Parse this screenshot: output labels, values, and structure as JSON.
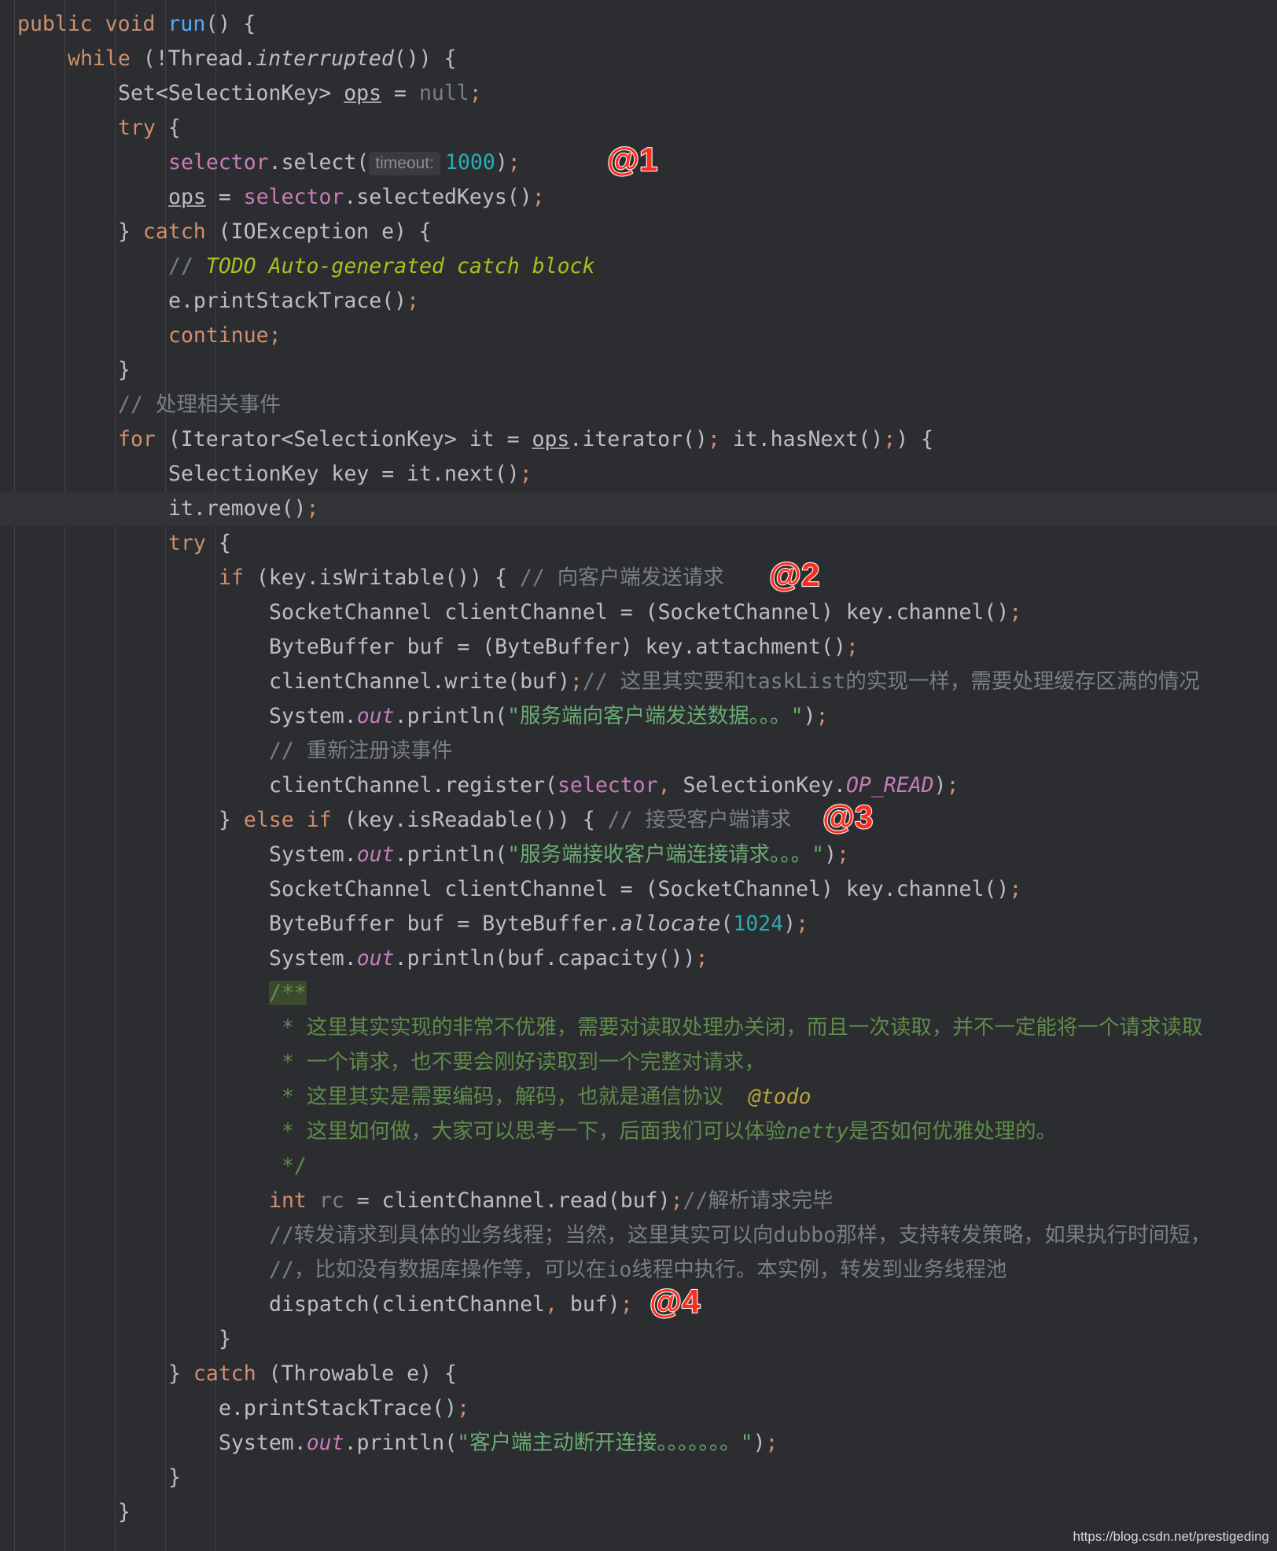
{
  "editor": {
    "lines": [
      {
        "indent": 0,
        "tokens": [
          [
            "kw",
            "public void "
          ],
          [
            "fn",
            "run"
          ],
          [
            "",
            "() {"
          ]
        ]
      },
      {
        "indent": 1,
        "tokens": [
          [
            "kw",
            "while "
          ],
          [
            "",
            "(!Thread."
          ],
          [
            "ital",
            "interrupted"
          ],
          [
            "",
            "()) {"
          ]
        ]
      },
      {
        "indent": 2,
        "tokens": [
          [
            "",
            "Set<SelectionKey> "
          ],
          [
            "und",
            "ops"
          ],
          [
            "",
            " = "
          ],
          [
            "dim",
            "null"
          ],
          [
            "kw",
            ";"
          ]
        ]
      },
      {
        "indent": 2,
        "tokens": [
          [
            "kw",
            "try "
          ],
          [
            "",
            "{"
          ]
        ]
      },
      {
        "indent": 3,
        "tokens": [
          [
            "fld",
            "selector"
          ],
          [
            "",
            ".select("
          ],
          [
            "hint",
            "timeout:"
          ],
          [
            "num",
            "1000"
          ],
          [
            "",
            ")"
          ],
          [
            "kw",
            ";"
          ]
        ]
      },
      {
        "indent": 3,
        "tokens": [
          [
            "und",
            "ops"
          ],
          [
            "",
            " = "
          ],
          [
            "fld",
            "selector"
          ],
          [
            "",
            ".selectedKeys()"
          ],
          [
            "kw",
            ";"
          ]
        ]
      },
      {
        "indent": 2,
        "tokens": [
          [
            "",
            "} "
          ],
          [
            "kw",
            "catch "
          ],
          [
            "",
            "(IOException e) {"
          ]
        ]
      },
      {
        "indent": 3,
        "tokens": [
          [
            "cmt",
            "// "
          ],
          [
            "todo",
            "TODO Auto-generated catch block"
          ]
        ]
      },
      {
        "indent": 3,
        "tokens": [
          [
            "",
            "e.printStackTrace()"
          ],
          [
            "kw",
            ";"
          ]
        ]
      },
      {
        "indent": 3,
        "tokens": [
          [
            "kw",
            "continue;"
          ]
        ]
      },
      {
        "indent": 2,
        "tokens": [
          [
            "",
            "}"
          ]
        ]
      },
      {
        "indent": 2,
        "tokens": [
          [
            "cmt",
            "// 处理相关事件"
          ]
        ]
      },
      {
        "indent": 2,
        "tokens": [
          [
            "kw",
            "for "
          ],
          [
            "",
            "(Iterator<SelectionKey> it = "
          ],
          [
            "und",
            "ops"
          ],
          [
            "",
            ".iterator()"
          ],
          [
            "kw",
            "; "
          ],
          [
            "",
            "it.hasNext()"
          ],
          [
            "kw",
            ";"
          ],
          [
            "",
            ") {"
          ]
        ]
      },
      {
        "indent": 3,
        "tokens": [
          [
            "",
            "SelectionKey key = it.next()"
          ],
          [
            "kw",
            ";"
          ]
        ]
      },
      {
        "indent": 3,
        "current": true,
        "tokens": [
          [
            "",
            "it.remove()"
          ],
          [
            "kw",
            ";"
          ]
        ]
      },
      {
        "indent": 3,
        "tokens": [
          [
            "kw",
            "try "
          ],
          [
            "",
            "{"
          ]
        ]
      },
      {
        "indent": 4,
        "tokens": [
          [
            "kw",
            "if "
          ],
          [
            "",
            "(key.isWritable()) { "
          ],
          [
            "cmt",
            "// 向客户端发送请求"
          ]
        ]
      },
      {
        "indent": 5,
        "tokens": [
          [
            "",
            "SocketChannel clientChannel = (SocketChannel) key.channel()"
          ],
          [
            "kw",
            ";"
          ]
        ]
      },
      {
        "indent": 5,
        "tokens": [
          [
            "",
            "ByteBuffer buf = (ByteBuffer) key.attachment()"
          ],
          [
            "kw",
            ";"
          ]
        ]
      },
      {
        "indent": 5,
        "tokens": [
          [
            "",
            "clientChannel.write(buf)"
          ],
          [
            "kw",
            ";"
          ],
          [
            "cmt",
            "// 这里其实要和taskList的实现一样，需要处理缓存区满的情况"
          ]
        ]
      },
      {
        "indent": 5,
        "tokens": [
          [
            "",
            "System."
          ],
          [
            "fld ital",
            "out"
          ],
          [
            "",
            ".println("
          ],
          [
            "str",
            "\"服务端向客户端发送数据。。。\""
          ],
          [
            "",
            ")"
          ],
          [
            "kw",
            ";"
          ]
        ]
      },
      {
        "indent": 5,
        "tokens": [
          [
            "cmt",
            "// 重新注册读事件"
          ]
        ]
      },
      {
        "indent": 5,
        "tokens": [
          [
            "",
            "clientChannel.register("
          ],
          [
            "fld",
            "selector"
          ],
          [
            "kw",
            ", "
          ],
          [
            "",
            "SelectionKey."
          ],
          [
            "fld ital",
            "OP_READ"
          ],
          [
            "",
            ")"
          ],
          [
            "kw",
            ";"
          ]
        ]
      },
      {
        "indent": 4,
        "tokens": [
          [
            "",
            "} "
          ],
          [
            "kw",
            "else if "
          ],
          [
            "",
            "(key.isReadable()) { "
          ],
          [
            "cmt",
            "// 接受客户端请求"
          ]
        ]
      },
      {
        "indent": 5,
        "tokens": [
          [
            "",
            "System."
          ],
          [
            "fld ital",
            "out"
          ],
          [
            "",
            ".println("
          ],
          [
            "str",
            "\"服务端接收客户端连接请求。。。\""
          ],
          [
            "",
            ")"
          ],
          [
            "kw",
            ";"
          ]
        ]
      },
      {
        "indent": 5,
        "tokens": [
          [
            "",
            "SocketChannel clientChannel = (SocketChannel) key.channel()"
          ],
          [
            "kw",
            ";"
          ]
        ]
      },
      {
        "indent": 5,
        "tokens": [
          [
            "",
            "ByteBuffer buf = ByteBuffer."
          ],
          [
            "ital",
            "allocate"
          ],
          [
            "",
            "("
          ],
          [
            "num",
            "1024"
          ],
          [
            "",
            ")"
          ],
          [
            "kw",
            ";"
          ]
        ]
      },
      {
        "indent": 5,
        "tokens": [
          [
            "",
            "System."
          ],
          [
            "fld ital",
            "out"
          ],
          [
            "",
            ".println(buf.capacity())"
          ],
          [
            "kw",
            ";"
          ]
        ]
      },
      {
        "indent": 5,
        "tokens": [
          [
            "docstart",
            "/**"
          ]
        ]
      },
      {
        "indent": 5,
        "tokens": [
          [
            "doc",
            " * 这里其实实现的非常不优雅，需要对读取处理办关闭，而且一次读取，并不一定能将一个请求读取"
          ]
        ]
      },
      {
        "indent": 5,
        "tokens": [
          [
            "doc",
            " * 一个请求，也不要会刚好读取到一个完整对请求，"
          ]
        ]
      },
      {
        "indent": 5,
        "tokens": [
          [
            "doc",
            " * 这里其实是需要编码，解码，也就是通信协议  "
          ],
          [
            "tag",
            "@todo"
          ]
        ]
      },
      {
        "indent": 5,
        "tokens": [
          [
            "doc",
            " * 这里如何做，大家可以思考一下，后面我们可以体验"
          ],
          [
            "doc ital",
            "netty"
          ],
          [
            "doc",
            "是否如何优雅处理的。"
          ]
        ]
      },
      {
        "indent": 5,
        "tokens": [
          [
            "doc",
            " */"
          ]
        ]
      },
      {
        "indent": 5,
        "tokens": [
          [
            "kw",
            "int "
          ],
          [
            "dim",
            "rc"
          ],
          [
            "",
            " = clientChannel.read(buf)"
          ],
          [
            "kw",
            ";"
          ],
          [
            "cmt",
            "//解析请求完毕"
          ]
        ]
      },
      {
        "indent": 5,
        "tokens": [
          [
            "cmt",
            "//转发请求到具体的业务线程；当然，这里其实可以向dubbo那样，支持转发策略，如果执行时间短，"
          ]
        ]
      },
      {
        "indent": 5,
        "tokens": [
          [
            "cmt",
            "//，比如没有数据库操作等，可以在io线程中执行。本实例，转发到业务线程池"
          ]
        ]
      },
      {
        "indent": 5,
        "tokens": [
          [
            "",
            "dispatch(clientChannel"
          ],
          [
            "kw",
            ", "
          ],
          [
            "",
            "buf)"
          ],
          [
            "kw",
            ";"
          ]
        ]
      },
      {
        "indent": 4,
        "tokens": [
          [
            "",
            "}"
          ]
        ]
      },
      {
        "indent": 3,
        "tokens": [
          [
            "",
            "} "
          ],
          [
            "kw",
            "catch "
          ],
          [
            "",
            "(Throwable e) {"
          ]
        ]
      },
      {
        "indent": 4,
        "tokens": [
          [
            "",
            "e.printStackTrace()"
          ],
          [
            "kw",
            ";"
          ]
        ]
      },
      {
        "indent": 4,
        "tokens": [
          [
            "",
            "System."
          ],
          [
            "fld ital",
            "out"
          ],
          [
            "",
            ".println("
          ],
          [
            "str",
            "\"客户端主动断开连接。。。。。。。\""
          ],
          [
            "",
            ")"
          ],
          [
            "kw",
            ";"
          ]
        ]
      },
      {
        "indent": 3,
        "tokens": [
          [
            "",
            "}"
          ]
        ]
      },
      {
        "indent": 2,
        "tokens": [
          [
            "",
            "}"
          ]
        ]
      }
    ]
  },
  "annotations": [
    {
      "text": "@1",
      "line": 4
    },
    {
      "text": "@2",
      "line": 16
    },
    {
      "text": "@3",
      "line": 23
    },
    {
      "text": "@4",
      "line": 37
    }
  ],
  "watermark": "https://blog.csdn.net/prestigeding",
  "colors": {
    "background": "#2b2d30",
    "keyword": "#cf8e6d",
    "method": "#56a8f5",
    "field": "#c77dbb",
    "number": "#2aacb8",
    "string": "#6aab73",
    "comment": "#7a7e85",
    "todo": "#a8c023",
    "marker": "#ff2b1c"
  }
}
